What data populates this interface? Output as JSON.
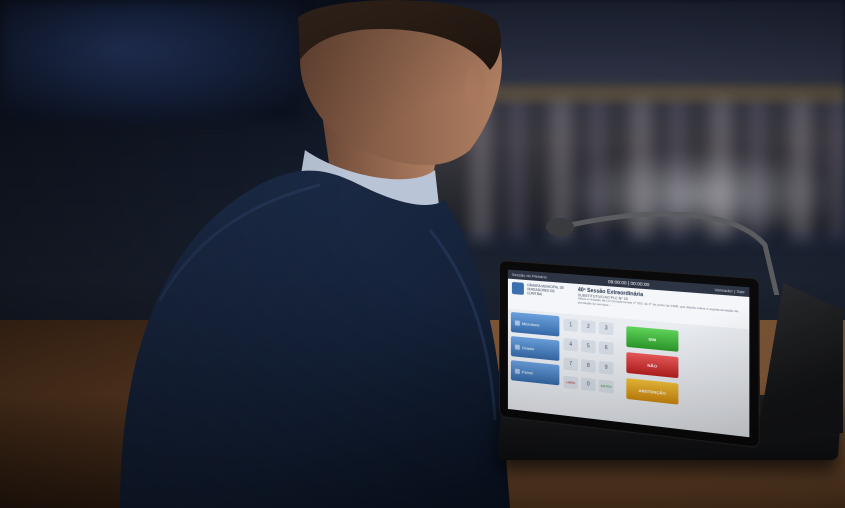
{
  "device_screen": {
    "topbar_left": "Sessão do Plenário",
    "clock": "09:00:00 | 00:00:00",
    "topbar_right": "Vereador | Sair",
    "org_name": "CÂMARA MUNICIPAL DE VEREADORES DE CURITIBA",
    "session_title": "40ª Sessão Extraordinária",
    "session_subtitle": "SUBSTITUTIVO AO PLC Nº 15",
    "session_text": "Altera a redação da Lei Complementar nº 010, de 1º de junho de 1998, que dispõe sobre a regulamentação da prestação de serviços ...",
    "side_buttons": [
      "Microfone",
      "Orador",
      "Painel"
    ],
    "keypad": [
      "1",
      "2",
      "3",
      "4",
      "5",
      "6",
      "7",
      "8",
      "9",
      "LIMPA",
      "0",
      "ENTRA"
    ],
    "vote_buttons": {
      "yes": "SIM",
      "no": "NÃO",
      "abstain": "ABSTENÇÃO"
    }
  },
  "colors": {
    "yes": "#2c9a2b",
    "no": "#b82020",
    "abstain": "#d08a0f",
    "button_blue": "#3569a8"
  }
}
